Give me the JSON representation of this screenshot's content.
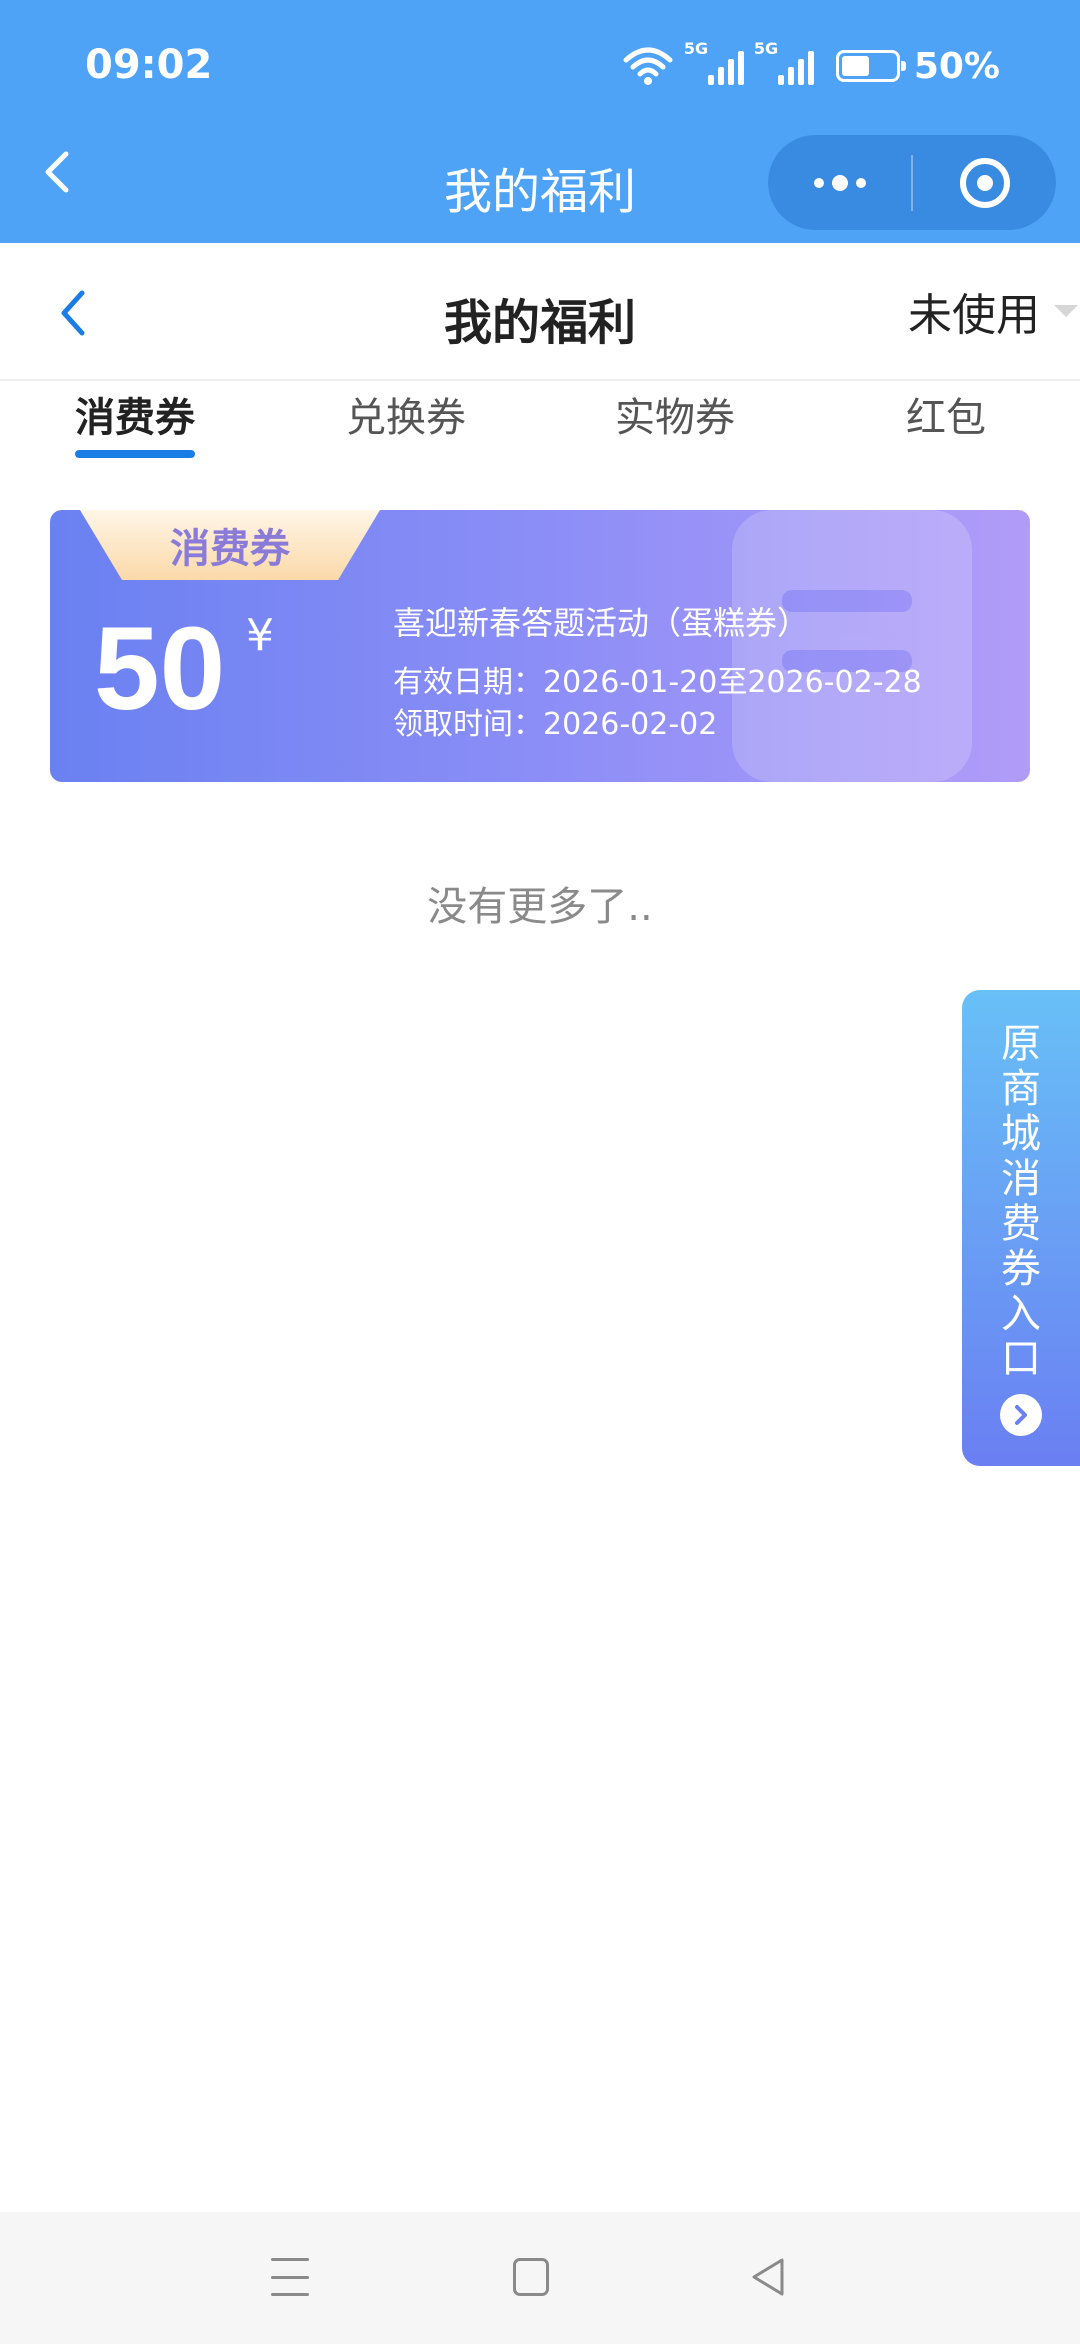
{
  "status_bar": {
    "time": "09:02",
    "network1": "5G",
    "network2": "5G",
    "battery_percent": "50%",
    "battery_level": 0.5,
    "icons": [
      "wifi-icon",
      "signal-5g-icon",
      "signal-5g-icon",
      "battery-icon"
    ]
  },
  "mini_program_header": {
    "title": "我的福利",
    "back_icon": "chevron-left-icon",
    "menu_icon": "more-dots-icon",
    "close_icon": "target-circle-icon"
  },
  "page_header": {
    "title": "我的福利",
    "filter_label": "未使用",
    "back_icon": "chevron-left-icon",
    "filter_icon": "caret-down-icon"
  },
  "tabs": [
    {
      "label": "消费券",
      "active": true
    },
    {
      "label": "兑换券",
      "active": false
    },
    {
      "label": "实物券",
      "active": false
    },
    {
      "label": "红包",
      "active": false
    }
  ],
  "coupons": [
    {
      "type_label": "消费券",
      "amount": "50",
      "currency": "¥",
      "name": "喜迎新春答题活动（蛋糕券）",
      "valid_period": "有效日期：2026-01-20至2026-02-28",
      "received_time": "领取时间：2026-02-02"
    }
  ],
  "empty_hint": "没有更多了..",
  "side_entry": {
    "label": "原商城消费券入口",
    "icon": "chevron-right-circle-icon"
  },
  "system_nav": {
    "icons": [
      "menu-icon",
      "home-square-icon",
      "back-triangle-icon"
    ]
  },
  "colors": {
    "header_blue": "#4ea3f7",
    "tab_active_underline": "#1a7de6",
    "coupon_gradient_start": "#6a81f1",
    "coupon_gradient_end": "#b19cf8",
    "ribbon_text": "#8a7bd8"
  }
}
